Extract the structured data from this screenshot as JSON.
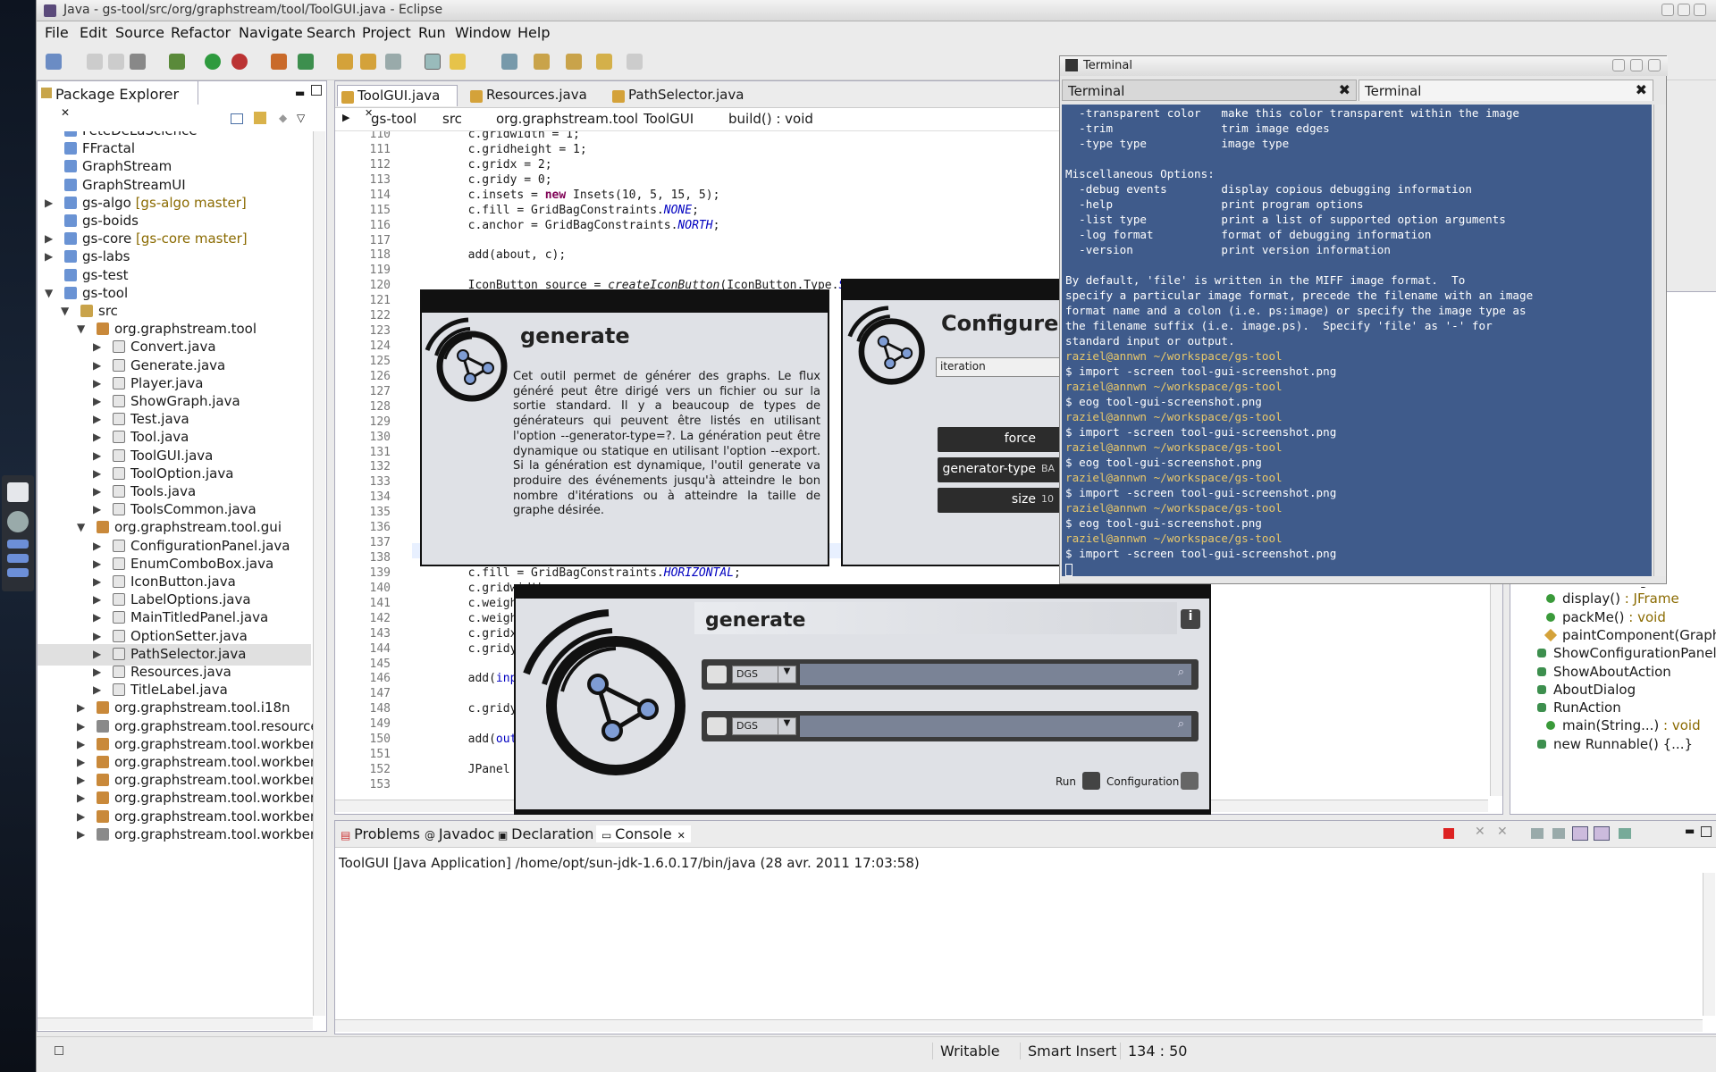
{
  "window": {
    "title": "Java - gs-tool/src/org/graphstream/tool/ToolGUI.java - Eclipse"
  },
  "menu": [
    "File",
    "Edit",
    "Source",
    "Refactor",
    "Navigate",
    "Search",
    "Project",
    "Run",
    "Window",
    "Help"
  ],
  "package_explorer": {
    "title": "Package Explorer",
    "items": [
      {
        "label": "FeteDeLaScience",
        "kind": "folder",
        "depth": 0,
        "arrow": ""
      },
      {
        "label": "FFractal",
        "kind": "folder",
        "depth": 0,
        "arrow": ""
      },
      {
        "label": "GraphStream",
        "kind": "folder",
        "depth": 0,
        "arrow": ""
      },
      {
        "label": "GraphStreamUI",
        "kind": "folder",
        "depth": 0,
        "arrow": ""
      },
      {
        "label": "gs-algo",
        "extra": " [gs-algo master]",
        "kind": "project",
        "depth": 0,
        "arrow": "▶"
      },
      {
        "label": "gs-boids",
        "kind": "folder",
        "depth": 0,
        "arrow": ""
      },
      {
        "label": "gs-core",
        "extra": " [gs-core master]",
        "kind": "project",
        "depth": 0,
        "arrow": "▶"
      },
      {
        "label": "gs-labs",
        "kind": "project",
        "depth": 0,
        "arrow": "▶"
      },
      {
        "label": "gs-test",
        "kind": "folder",
        "depth": 0,
        "arrow": ""
      },
      {
        "label": "gs-tool",
        "kind": "project",
        "depth": 0,
        "arrow": "▼"
      },
      {
        "label": "src",
        "kind": "src",
        "depth": 1,
        "arrow": "▼"
      },
      {
        "label": "org.graphstream.tool",
        "kind": "package",
        "depth": 2,
        "arrow": "▼"
      },
      {
        "label": "Convert.java",
        "kind": "java",
        "depth": 3,
        "arrow": "▶"
      },
      {
        "label": "Generate.java",
        "kind": "java",
        "depth": 3,
        "arrow": "▶"
      },
      {
        "label": "Player.java",
        "kind": "java",
        "depth": 3,
        "arrow": "▶"
      },
      {
        "label": "ShowGraph.java",
        "kind": "java",
        "depth": 3,
        "arrow": "▶"
      },
      {
        "label": "Test.java",
        "kind": "java",
        "depth": 3,
        "arrow": "▶"
      },
      {
        "label": "Tool.java",
        "kind": "java",
        "depth": 3,
        "arrow": "▶"
      },
      {
        "label": "ToolGUI.java",
        "kind": "java",
        "depth": 3,
        "arrow": "▶"
      },
      {
        "label": "ToolOption.java",
        "kind": "java",
        "depth": 3,
        "arrow": "▶"
      },
      {
        "label": "Tools.java",
        "kind": "java",
        "depth": 3,
        "arrow": "▶"
      },
      {
        "label": "ToolsCommon.java",
        "kind": "java",
        "depth": 3,
        "arrow": "▶"
      },
      {
        "label": "org.graphstream.tool.gui",
        "kind": "package",
        "depth": 2,
        "arrow": "▼"
      },
      {
        "label": "ConfigurationPanel.java",
        "kind": "java",
        "depth": 3,
        "arrow": "▶"
      },
      {
        "label": "EnumComboBox.java",
        "kind": "java",
        "depth": 3,
        "arrow": "▶"
      },
      {
        "label": "IconButton.java",
        "kind": "java",
        "depth": 3,
        "arrow": "▶"
      },
      {
        "label": "LabelOptions.java",
        "kind": "java",
        "depth": 3,
        "arrow": "▶"
      },
      {
        "label": "MainTitledPanel.java",
        "kind": "java",
        "depth": 3,
        "arrow": "▶"
      },
      {
        "label": "OptionSetter.java",
        "kind": "java",
        "depth": 3,
        "arrow": "▶"
      },
      {
        "label": "PathSelector.java",
        "kind": "java",
        "depth": 3,
        "arrow": "▶",
        "selected": true
      },
      {
        "label": "Resources.java",
        "kind": "java",
        "depth": 3,
        "arrow": "▶"
      },
      {
        "label": "TitleLabel.java",
        "kind": "java",
        "depth": 3,
        "arrow": "▶"
      },
      {
        "label": "org.graphstream.tool.i18n",
        "kind": "package",
        "depth": 2,
        "arrow": "▶"
      },
      {
        "label": "org.graphstream.tool.resources",
        "kind": "pkg2",
        "depth": 2,
        "arrow": "▶"
      },
      {
        "label": "org.graphstream.tool.workbenc",
        "kind": "package",
        "depth": 2,
        "arrow": "▶"
      },
      {
        "label": "org.graphstream.tool.workbenc",
        "kind": "package",
        "depth": 2,
        "arrow": "▶"
      },
      {
        "label": "org.graphstream.tool.workbenc",
        "kind": "package",
        "depth": 2,
        "arrow": "▶"
      },
      {
        "label": "org.graphstream.tool.workbenc",
        "kind": "package",
        "depth": 2,
        "arrow": "▶"
      },
      {
        "label": "org.graphstream.tool.workbenc",
        "kind": "package",
        "depth": 2,
        "arrow": "▶"
      },
      {
        "label": "org.graphstream.tool.workbenc",
        "kind": "pkg2",
        "depth": 2,
        "arrow": "▶"
      }
    ]
  },
  "editor": {
    "tabs": [
      {
        "label": "ToolGUI.java",
        "active": true
      },
      {
        "label": "Resources.java"
      },
      {
        "label": "PathSelector.java"
      }
    ],
    "breadcrumb": [
      "gs-tool",
      "src",
      "org.graphstream.tool",
      "ToolGUI",
      "build() : void"
    ],
    "lines": [
      {
        "n": "110",
        "t": "        c.gridwidth = 1;"
      },
      {
        "n": "111",
        "t": "        c.gridheight = 1;"
      },
      {
        "n": "112",
        "t": "        c.gridx = 2;"
      },
      {
        "n": "113",
        "t": "        c.gridy = 0;"
      },
      {
        "n": "114",
        "t": "        c.insets = new Insets(10, 5, 15, 5);"
      },
      {
        "n": "115",
        "t": "        c.fill = GridBagConstraints.NONE;"
      },
      {
        "n": "116",
        "t": "        c.anchor = GridBagConstraints.NORTH;"
      },
      {
        "n": "117",
        "t": ""
      },
      {
        "n": "118",
        "t": "        add(about, c);"
      },
      {
        "n": "119",
        "t": ""
      },
      {
        "n": "120",
        "t": "        IconButton source = createIconButton(IconButton.Type.SOURCE"
      },
      {
        "n": "121",
        "t": ""
      },
      {
        "n": "122",
        "t": ""
      },
      {
        "n": "123",
        "t": ""
      },
      {
        "n": "124",
        "t": ""
      },
      {
        "n": "125",
        "t": ""
      },
      {
        "n": "126",
        "t": ""
      },
      {
        "n": "127",
        "t": ""
      },
      {
        "n": "128",
        "t": ""
      },
      {
        "n": "129",
        "t": ""
      },
      {
        "n": "130",
        "t": ""
      },
      {
        "n": "131",
        "t": ""
      },
      {
        "n": "132",
        "t": ""
      },
      {
        "n": "133",
        "t": ""
      },
      {
        "n": "134",
        "t": ""
      },
      {
        "n": "135",
        "t": ""
      },
      {
        "n": "136",
        "t": ""
      },
      {
        "n": "137",
        "t": ""
      },
      {
        "n": "138",
        "t": ""
      },
      {
        "n": "139",
        "t": "        c.fill = GridBagConstraints.HORIZONTAL;"
      },
      {
        "n": "140",
        "t": "        c.gridwidth"
      },
      {
        "n": "141",
        "t": "        c.weightx ="
      },
      {
        "n": "142",
        "t": "        c.weighty ="
      },
      {
        "n": "143",
        "t": "        c.gridx = 1"
      },
      {
        "n": "144",
        "t": "        c.gridy = 1"
      },
      {
        "n": "145",
        "t": ""
      },
      {
        "n": "146",
        "t": "        add(inputSe"
      },
      {
        "n": "147",
        "t": ""
      },
      {
        "n": "148",
        "t": "        c.gridy++;"
      },
      {
        "n": "149",
        "t": ""
      },
      {
        "n": "150",
        "t": "        add(outputSe"
      },
      {
        "n": "151",
        "t": ""
      },
      {
        "n": "152",
        "t": "        JPanel botto"
      },
      {
        "n": "153",
        "t": ""
      }
    ]
  },
  "outline": {
    "items": [
      {
        "label": "createConfigurationPane",
        "kind": "method"
      },
      {
        "label": "display()",
        "type": " : JFrame",
        "kind": "method"
      },
      {
        "label": "packMe()",
        "type": " : void",
        "kind": "method"
      },
      {
        "label": "paintComponent(Graphic",
        "kind": "method2"
      },
      {
        "label": "ShowConfigurationPanel",
        "kind": "class"
      },
      {
        "label": "ShowAboutAction",
        "kind": "class"
      },
      {
        "label": "AboutDialog",
        "kind": "class"
      },
      {
        "label": "RunAction",
        "kind": "class"
      },
      {
        "label": "main(String...)",
        "type": " : void",
        "kind": "main"
      },
      {
        "label": "new Runnable() {...}",
        "kind": "class"
      }
    ]
  },
  "console": {
    "tabs": [
      "Problems",
      "Javadoc",
      "Declaration",
      "Console"
    ],
    "header": "ToolGUI [Java Application] /home/opt/sun-jdk-1.6.0.17/bin/java (28 avr. 2011 17:03:58)"
  },
  "status": {
    "mode": "Writable",
    "insert": "Smart Insert",
    "position": "134 : 50"
  },
  "terminal": {
    "title": "Terminal",
    "tabs": [
      "Terminal",
      "Terminal"
    ],
    "lines": [
      {
        "t": "  -transparent color   make this color transparent within the image",
        "c": "w"
      },
      {
        "t": "  -trim                trim image edges",
        "c": "w"
      },
      {
        "t": "  -type type           image type",
        "c": "w"
      },
      {
        "t": "",
        "c": "w"
      },
      {
        "t": "Miscellaneous Options:",
        "c": "w"
      },
      {
        "t": "  -debug events        display copious debugging information",
        "c": "w"
      },
      {
        "t": "  -help                print program options",
        "c": "w"
      },
      {
        "t": "  -list type           print a list of supported option arguments",
        "c": "w"
      },
      {
        "t": "  -log format          format of debugging information",
        "c": "w"
      },
      {
        "t": "  -version             print version information",
        "c": "w"
      },
      {
        "t": "",
        "c": "w"
      },
      {
        "t": "By default, 'file' is written in the MIFF image format.  To",
        "c": "w"
      },
      {
        "t": "specify a particular image format, precede the filename with an image",
        "c": "w"
      },
      {
        "t": "format name and a colon (i.e. ps:image) or specify the image type as",
        "c": "w"
      },
      {
        "t": "the filename suffix (i.e. image.ps).  Specify 'file' as '-' for",
        "c": "w"
      },
      {
        "t": "standard input or output.",
        "c": "w"
      },
      {
        "t": "raziel@annwn ~/workspace/gs-tool",
        "c": "y"
      },
      {
        "t": "$ import -screen tool-gui-screenshot.png",
        "c": "w"
      },
      {
        "t": "raziel@annwn ~/workspace/gs-tool",
        "c": "y"
      },
      {
        "t": "$ eog tool-gui-screenshot.png",
        "c": "w"
      },
      {
        "t": "raziel@annwn ~/workspace/gs-tool",
        "c": "y"
      },
      {
        "t": "$ import -screen tool-gui-screenshot.png",
        "c": "w"
      },
      {
        "t": "raziel@annwn ~/workspace/gs-tool",
        "c": "y"
      },
      {
        "t": "$ eog tool-gui-screenshot.png",
        "c": "w"
      },
      {
        "t": "raziel@annwn ~/workspace/gs-tool",
        "c": "y"
      },
      {
        "t": "$ import -screen tool-gui-screenshot.png",
        "c": "w"
      },
      {
        "t": "raziel@annwn ~/workspace/gs-tool",
        "c": "y"
      },
      {
        "t": "$ eog tool-gui-screenshot.png",
        "c": "w"
      },
      {
        "t": "raziel@annwn ~/workspace/gs-tool",
        "c": "y"
      },
      {
        "t": "$ import -screen tool-gui-screenshot.png",
        "c": "w"
      }
    ]
  },
  "about_dialog": {
    "title": "generate",
    "text": "Cet outil permet de générer des graphs. Le flux généré peut être dirigé vers un fichier ou sur la sortie standard. Il y a beaucoup de types de générateurs qui peuvent être listés en utilisant l'option --generator-type=?. La génération peut être dynamique ou statique en utilisant l'option --export. Si la génération est dynamique, l'outil generate va produire des événements jusqu'à atteindre le bon nombre d'itérations ou à atteindre la taille de graphe désirée."
  },
  "config_dialog": {
    "title": "Configure g",
    "field_value": "iteration",
    "rows": [
      "force",
      "generator-type",
      "size"
    ],
    "row_values": [
      "",
      "BA",
      "10"
    ]
  },
  "main_dialog": {
    "title": "generate",
    "input_format": "DGS",
    "output_format": "DGS",
    "run_label": "Run",
    "config_label": "Configuration"
  },
  "colors": {
    "terminal_bg": "#3f5b8b",
    "prompt": "#e9c86a",
    "keyword": "#7f0055",
    "static": "#0000c0"
  }
}
